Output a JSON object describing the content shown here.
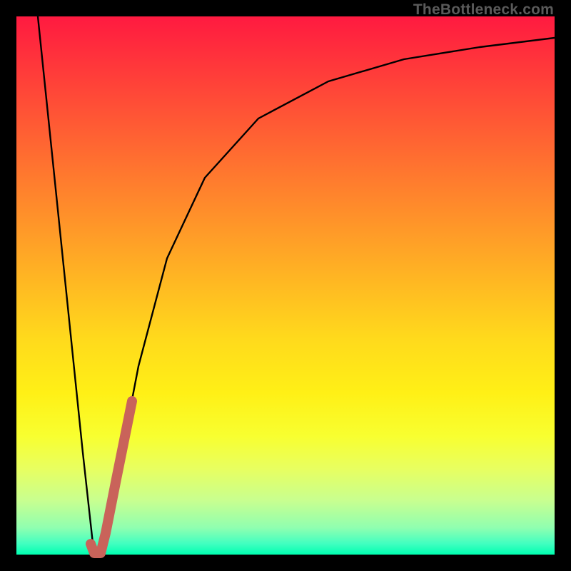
{
  "watermark": "TheBottleneck.com",
  "chart_data": {
    "type": "line",
    "title": "",
    "xlabel": "",
    "ylabel": "",
    "xlim": [
      0,
      100
    ],
    "ylim": [
      0,
      100
    ],
    "grid": false,
    "legend": false,
    "background_gradient": {
      "stops": [
        {
          "pos": 0,
          "color": "#ff1a40"
        },
        {
          "pos": 50,
          "color": "#ffda1c"
        },
        {
          "pos": 80,
          "color": "#f8ff30"
        },
        {
          "pos": 100,
          "color": "#00ffb0"
        }
      ]
    },
    "series": [
      {
        "name": "bottleneck-v-curve",
        "values": [
          {
            "x": 4.0,
            "y": 100.0
          },
          {
            "x": 6.8,
            "y": 73.0
          },
          {
            "x": 9.6,
            "y": 46.0
          },
          {
            "x": 12.4,
            "y": 19.0
          },
          {
            "x": 14.3,
            "y": 1.0
          },
          {
            "x": 15.0,
            "y": 0.0
          },
          {
            "x": 16.2,
            "y": 3.0
          },
          {
            "x": 18.8,
            "y": 15.0
          },
          {
            "x": 22.7,
            "y": 35.0
          },
          {
            "x": 28.0,
            "y": 55.0
          },
          {
            "x": 35.0,
            "y": 70.0
          },
          {
            "x": 45.0,
            "y": 81.0
          },
          {
            "x": 58.0,
            "y": 88.0
          },
          {
            "x": 72.0,
            "y": 92.0
          },
          {
            "x": 86.0,
            "y": 94.3
          },
          {
            "x": 100.0,
            "y": 96.0
          }
        ]
      },
      {
        "name": "highlight-segment",
        "color": "#c9635a",
        "values": [
          {
            "x": 13.8,
            "y": 2.0
          },
          {
            "x": 14.5,
            "y": 0.2
          },
          {
            "x": 15.6,
            "y": 0.2
          },
          {
            "x": 16.6,
            "y": 4.0
          },
          {
            "x": 18.6,
            "y": 14.0
          },
          {
            "x": 21.5,
            "y": 28.5
          }
        ]
      }
    ]
  }
}
